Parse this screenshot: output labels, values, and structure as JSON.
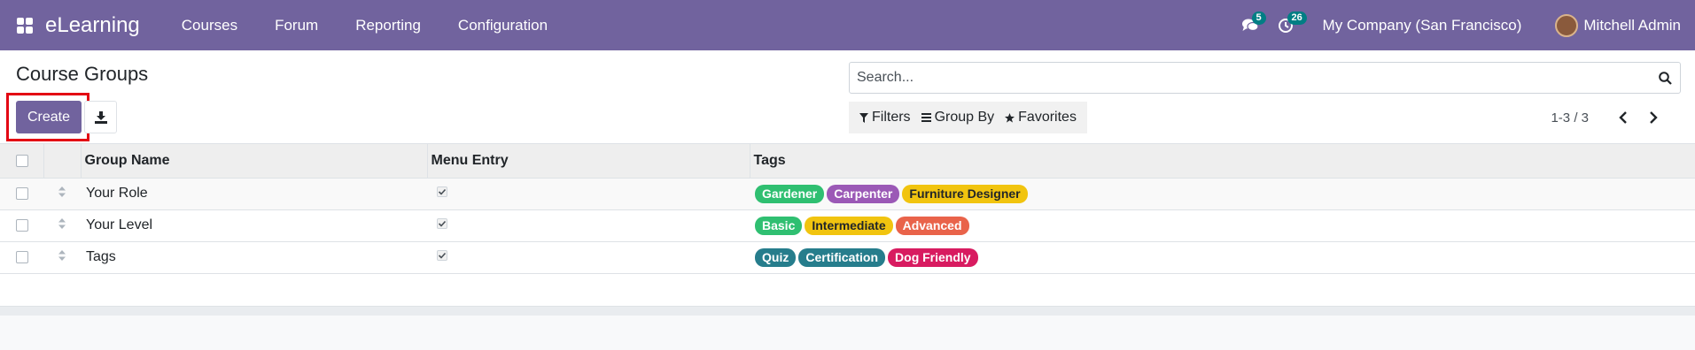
{
  "navbar": {
    "app_name": "eLearning",
    "menu": [
      "Courses",
      "Forum",
      "Reporting",
      "Configuration"
    ],
    "messages_count": "5",
    "activities_count": "26",
    "company": "My Company (San Francisco)",
    "user": "Mitchell Admin",
    "bg_color": "#71639e"
  },
  "control_panel": {
    "title": "Course Groups",
    "create_label": "Create",
    "search_placeholder": "Search...",
    "filters_label": "Filters",
    "groupby_label": "Group By",
    "favorites_label": "Favorites",
    "pager": "1-3 / 3"
  },
  "table": {
    "columns": [
      "Group Name",
      "Menu Entry",
      "Tags"
    ],
    "rows": [
      {
        "name": "Your Role",
        "menu_entry": true,
        "tags": [
          {
            "label": "Gardener",
            "color": "#2fbf71"
          },
          {
            "label": "Carpenter",
            "color": "#9b59b6"
          },
          {
            "label": "Furniture Designer",
            "color": "#f1c40f",
            "text_color": "#212529"
          }
        ]
      },
      {
        "name": "Your Level",
        "menu_entry": true,
        "tags": [
          {
            "label": "Basic",
            "color": "#2fbf71"
          },
          {
            "label": "Intermediate",
            "color": "#f1c40f",
            "text_color": "#212529"
          },
          {
            "label": "Advanced",
            "color": "#e9634a"
          }
        ]
      },
      {
        "name": "Tags",
        "menu_entry": true,
        "tags": [
          {
            "label": "Quiz",
            "color": "#267d8c"
          },
          {
            "label": "Certification",
            "color": "#267d8c"
          },
          {
            "label": "Dog Friendly",
            "color": "#d81b60"
          }
        ]
      }
    ]
  }
}
